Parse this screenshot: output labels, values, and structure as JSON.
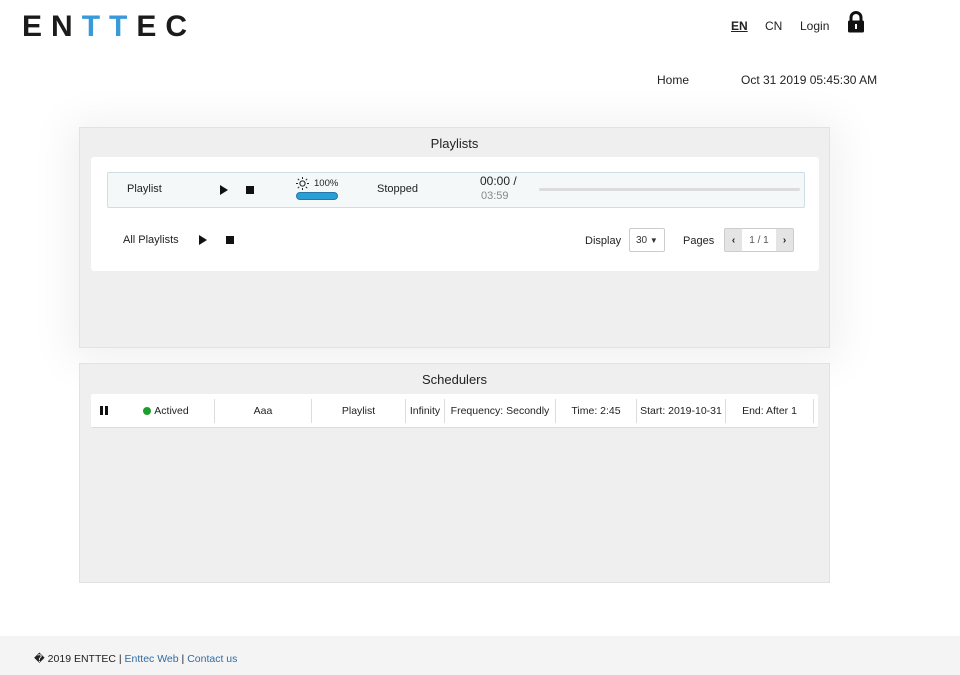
{
  "brand": {
    "logo_part1": "EN",
    "logo_accent": "TT",
    "logo_part2": "EC",
    "accent_color": "#3a9ad9"
  },
  "header": {
    "languages": [
      {
        "label": "EN",
        "active": true
      },
      {
        "label": "CN",
        "active": false
      }
    ],
    "login_label": "Login",
    "lock_icon": "lock-icon",
    "nav_home": "Home",
    "datetime": "Oct 31 2019 05:45:30 AM"
  },
  "playlists": {
    "title": "Playlists",
    "row": {
      "name": "Playlist",
      "brightness_label": "100%",
      "brightness_value": 1.0,
      "status": "Stopped",
      "time_elapsed": "00:00 /",
      "time_total": "03:59",
      "progress": 0
    },
    "all_label": "All Playlists",
    "display_label": "Display",
    "display_value": "30",
    "pages_label": "Pages",
    "pages_value": "1 / 1"
  },
  "schedulers": {
    "title": "Schedulers",
    "row": {
      "status": "Actived",
      "status_color": "#1c9f2a",
      "name": "Aaa",
      "type": "Playlist",
      "repeat": "Infinity",
      "frequency": "Frequency: Secondly",
      "time": "Time: 2:45",
      "start": "Start: 2019-10-31",
      "end": "End: After 1"
    }
  },
  "footer": {
    "copyright": "� 2019 ENTTEC |",
    "link1": "Enttec Web",
    "separator": "|",
    "link2": "Contact us"
  }
}
